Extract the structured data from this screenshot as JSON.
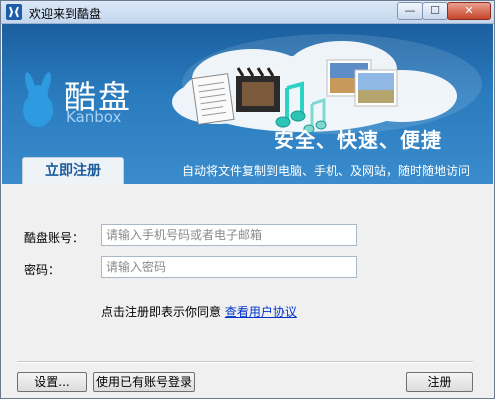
{
  "window": {
    "title": "欢迎来到酷盘"
  },
  "banner": {
    "logo_text": "酷盘",
    "logo_sub": "Kanbox",
    "slogan": "安全、快速、便捷",
    "subslogan": "自动将文件复制到电脑、手机、及网站，随时随地访问"
  },
  "tab": {
    "label": "立即注册"
  },
  "form": {
    "account_label": "酷盘账号：",
    "account_placeholder": "请输入手机号码或者电子邮箱",
    "password_label": "密码：",
    "password_placeholder": "请输入密码",
    "agree_text": "点击注册即表示你同意",
    "agree_link": "查看用户协议"
  },
  "buttons": {
    "settings": "设置...",
    "login_existing": "使用已有账号登录",
    "register": "注册"
  },
  "colors": {
    "banner_blue": "#2a7cbf",
    "tab_text": "#1b5b9a",
    "link": "#0033cc",
    "close_red": "#c7432a"
  }
}
